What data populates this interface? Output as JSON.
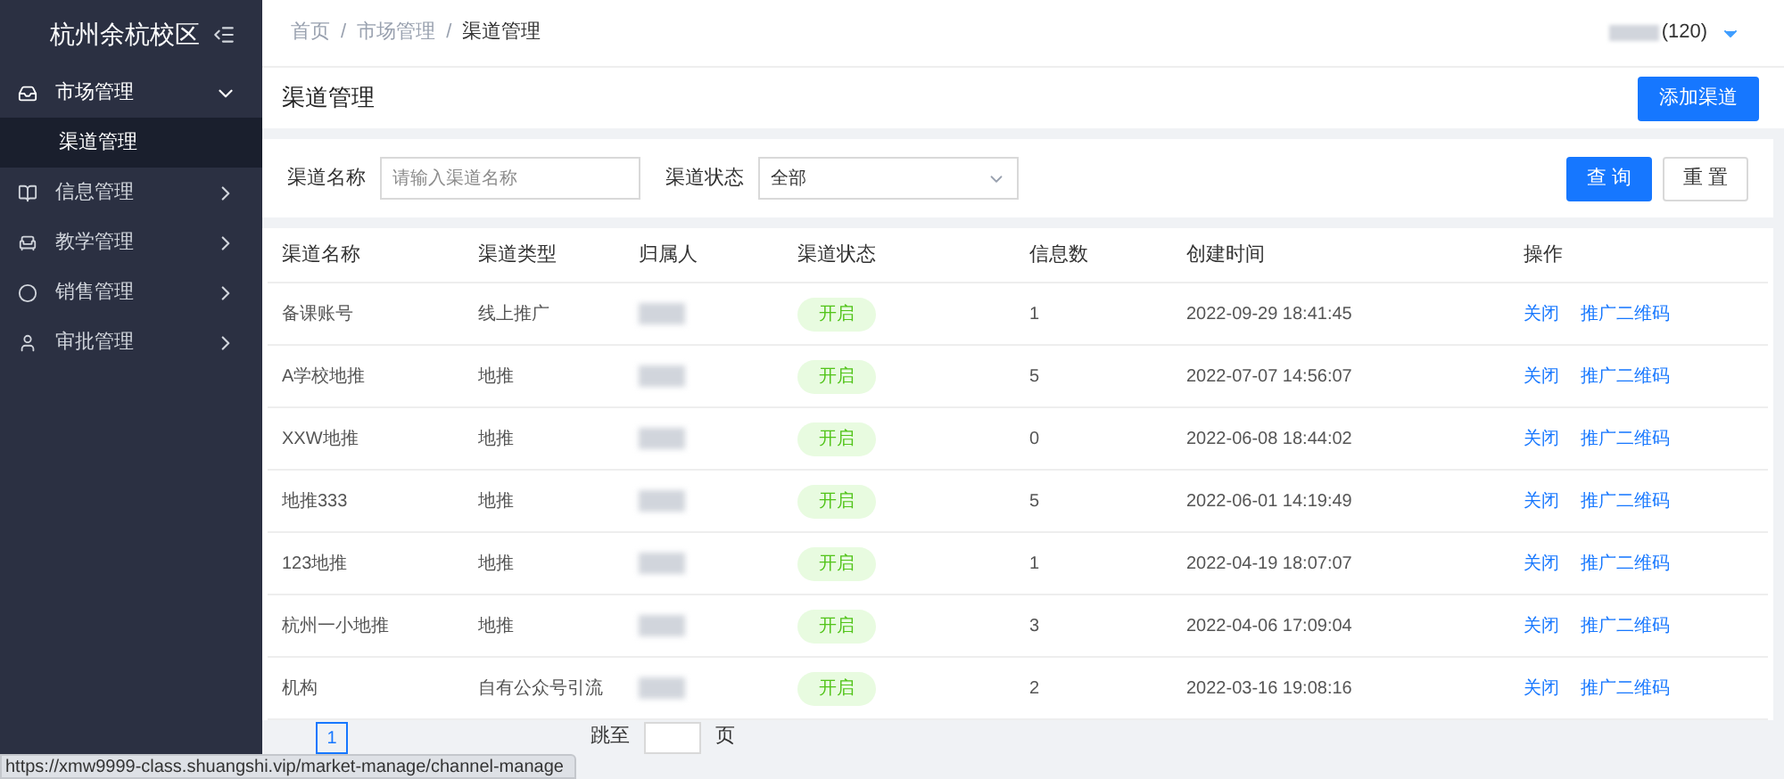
{
  "sidebar": {
    "title": "杭州余杭校区",
    "items": [
      {
        "label": "市场管理",
        "expanded": true,
        "children": [
          {
            "label": "渠道管理",
            "selected": true
          }
        ]
      },
      {
        "label": "信息管理",
        "expanded": false
      },
      {
        "label": "教学管理",
        "expanded": false
      },
      {
        "label": "销售管理",
        "expanded": false
      },
      {
        "label": "审批管理",
        "expanded": false
      }
    ]
  },
  "breadcrumb": [
    "首页",
    "市场管理",
    "渠道管理"
  ],
  "breadcrumb_separator": "/",
  "user": {
    "name_suffix": "(120)"
  },
  "page_title": "渠道管理",
  "add_button": "添加渠道",
  "filters": {
    "name_label": "渠道名称",
    "name_placeholder": "请输入渠道名称",
    "status_label": "渠道状态",
    "status_value": "全部",
    "query_button": "查 询",
    "reset_button": "重 置"
  },
  "table": {
    "columns": [
      "渠道名称",
      "渠道类型",
      "归属人",
      "渠道状态",
      "信息数",
      "创建时间",
      "操作"
    ],
    "rows": [
      {
        "name": "备课账号",
        "type": "线上推广",
        "status": "开启",
        "count": "1",
        "created": "2022-09-29 18:41:45",
        "actions": [
          "关闭",
          "推广二维码"
        ]
      },
      {
        "name": "A学校地推",
        "type": "地推",
        "status": "开启",
        "count": "5",
        "created": "2022-07-07 14:56:07",
        "actions": [
          "关闭",
          "推广二维码"
        ]
      },
      {
        "name": "XXW地推",
        "type": "地推",
        "status": "开启",
        "count": "0",
        "created": "2022-06-08 18:44:02",
        "actions": [
          "关闭",
          "推广二维码"
        ]
      },
      {
        "name": "地推333",
        "type": "地推",
        "status": "开启",
        "count": "5",
        "created": "2022-06-01 14:19:49",
        "actions": [
          "关闭",
          "推广二维码"
        ]
      },
      {
        "name": "123地推",
        "type": "地推",
        "status": "开启",
        "count": "1",
        "created": "2022-04-19 18:07:07",
        "actions": [
          "关闭",
          "推广二维码"
        ]
      },
      {
        "name": "杭州一小地推",
        "type": "地推",
        "status": "开启",
        "count": "3",
        "created": "2022-04-06 17:09:04",
        "actions": [
          "关闭",
          "推广二维码"
        ]
      },
      {
        "name": "机构",
        "type": "自有公众号引流",
        "status": "开启",
        "count": "2",
        "created": "2022-03-16 19:08:16",
        "actions": [
          "关闭",
          "推广二维码"
        ]
      }
    ]
  },
  "pagination": {
    "current_page": "1",
    "jump_label": "跳至",
    "page_unit": "页"
  },
  "status_url": "https://xmw9999-class.shuangshi.vip/market-manage/channel-manage"
}
